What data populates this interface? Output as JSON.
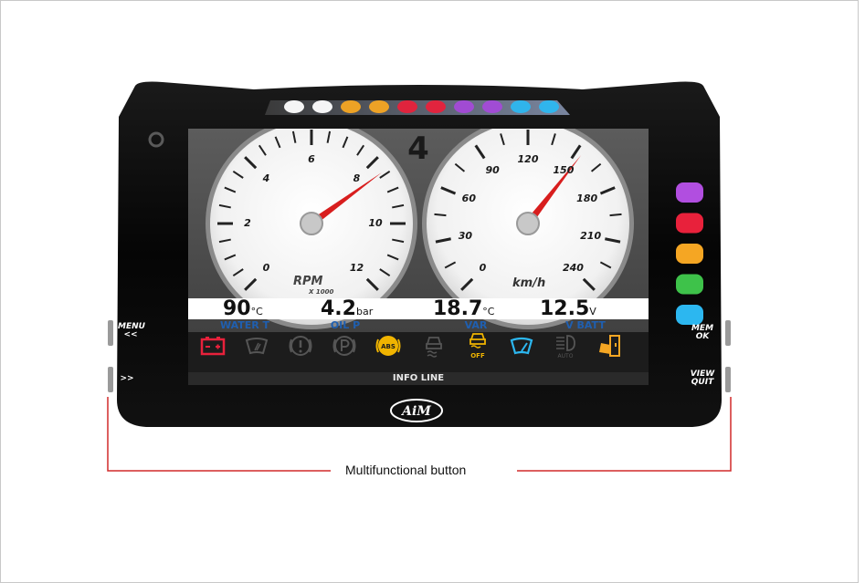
{
  "gear": "4",
  "rpm_gauge": {
    "label": "RPM",
    "sublabel": "X 1000",
    "ticks": [
      "0",
      "2",
      "4",
      "6",
      "8",
      "10",
      "12"
    ]
  },
  "speed_gauge": {
    "label": "km/h",
    "ticks": [
      "0",
      "30",
      "60",
      "90",
      "120",
      "150",
      "180",
      "210",
      "240"
    ]
  },
  "values": [
    {
      "value": "90",
      "unit": "°C",
      "channel": "WATER T"
    },
    {
      "value": "4.2",
      "unit": "bar",
      "channel": "OIL P"
    },
    {
      "value": "18.7",
      "unit": "°C",
      "channel": "VAR"
    },
    {
      "value": "12.5",
      "unit": "V",
      "channel": "V BATT"
    }
  ],
  "icons": [
    "battery-icon",
    "windshield-icon",
    "brake-warning-icon",
    "parking-brake-icon",
    "abs-icon",
    "traction-control-icon",
    "traction-control-off-icon",
    "wiper-icon",
    "auto-headlight-icon",
    "door-open-icon"
  ],
  "icon_texts": {
    "abs": "ABS",
    "off": "OFF",
    "auto": "AUTO"
  },
  "info_line": "INFO LINE",
  "buttons": {
    "left_top": "MENU\n<<",
    "left_bottom": ">>",
    "right_top": "MEM\nOK",
    "right_bottom": "VIEW\nQUIT"
  },
  "brand": "AiM",
  "caption": "Multifunctional button",
  "colors": {
    "shift_leds": [
      "#ffffff",
      "#ffffff",
      "#f5a623",
      "#f5a623",
      "#e8213b",
      "#e8213b",
      "#a44ad8",
      "#a44ad8",
      "#2cb7f0",
      "#2cb7f0"
    ],
    "side_leds": [
      "#b14ee0",
      "#e8213b",
      "#f5a623",
      "#3ec24a",
      "#2cb7f0"
    ],
    "needle": "#d81e1e",
    "channel_label": "#1f5fb0",
    "callout_line": "#d12a2a"
  }
}
